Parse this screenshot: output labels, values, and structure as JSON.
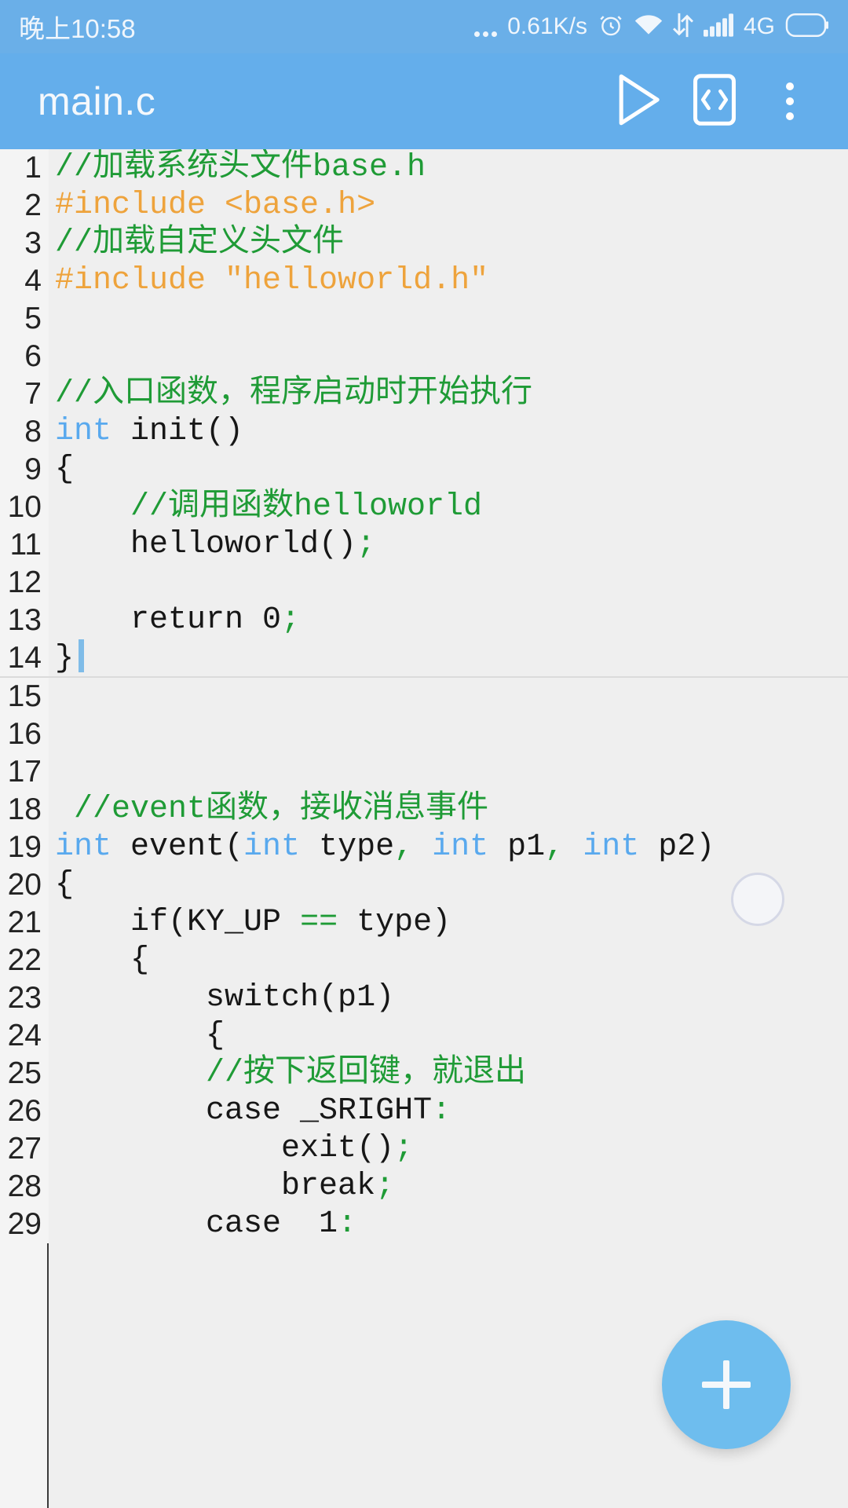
{
  "status_bar": {
    "clock": "晚上10:58",
    "network_speed": "0.61K/s",
    "network_type": "4G",
    "icons": [
      "more-dots-icon",
      "alarm-clock-icon",
      "wifi-icon",
      "data-transfer-icon",
      "signal-bars-icon",
      "battery-icon"
    ]
  },
  "app_bar": {
    "title": "main.c",
    "run_label": "run-icon",
    "code_label": "code-brackets-icon",
    "menu_label": "overflow-menu-icon"
  },
  "fab": {
    "label": "+",
    "color": "#6EBDEE"
  },
  "colors": {
    "accent": "#64AEEB",
    "status_bar": "#6AAFE8",
    "editor_bg": "#EFEFEF",
    "gutter_bg": "#F4F4F4",
    "comment": "#1F9B36",
    "preprocessor": "#EEA33C",
    "keyword": "#59A9EE",
    "punctuation": "#1F9B36",
    "text": "#171717",
    "caret": "#7FBCE8"
  },
  "editor": {
    "file_name": "main.c",
    "caret_line": 14,
    "lines": [
      {
        "n": "1",
        "tokens": [
          {
            "t": "//加载系统头文件base.h",
            "c": "comment"
          }
        ]
      },
      {
        "n": "2",
        "tokens": [
          {
            "t": "#include <base.h>",
            "c": "pre"
          }
        ]
      },
      {
        "n": "3",
        "tokens": [
          {
            "t": "//加载自定义头文件",
            "c": "comment"
          }
        ]
      },
      {
        "n": "4",
        "tokens": [
          {
            "t": "#include \"helloworld.h\"",
            "c": "pre"
          }
        ]
      },
      {
        "n": "5",
        "tokens": []
      },
      {
        "n": "6",
        "tokens": []
      },
      {
        "n": "7",
        "tokens": [
          {
            "t": "//入口函数，程序启动时开始执行",
            "c": "comment"
          }
        ]
      },
      {
        "n": "8",
        "tokens": [
          {
            "t": "int",
            "c": "kw"
          },
          {
            "t": " init()",
            "c": "plain"
          }
        ]
      },
      {
        "n": "9",
        "tokens": [
          {
            "t": "{",
            "c": "plain"
          }
        ]
      },
      {
        "n": "10",
        "tokens": [
          {
            "t": "    //调用函数helloworld",
            "c": "comment"
          }
        ]
      },
      {
        "n": "11",
        "tokens": [
          {
            "t": "    helloworld()",
            "c": "plain"
          },
          {
            "t": ";",
            "c": "punc"
          }
        ]
      },
      {
        "n": "12",
        "tokens": []
      },
      {
        "n": "13",
        "tokens": [
          {
            "t": "    return 0",
            "c": "plain"
          },
          {
            "t": ";",
            "c": "punc"
          }
        ]
      },
      {
        "n": "14",
        "tokens": [
          {
            "t": "}",
            "c": "plain"
          }
        ],
        "caret": true,
        "divider_below": true
      },
      {
        "n": "15",
        "tokens": []
      },
      {
        "n": "16",
        "tokens": []
      },
      {
        "n": "17",
        "tokens": []
      },
      {
        "n": "18",
        "tokens": [
          {
            "t": " //event函数，接收消息事件",
            "c": "comment"
          }
        ]
      },
      {
        "n": "19",
        "tokens": [
          {
            "t": "int",
            "c": "kw"
          },
          {
            "t": " event(",
            "c": "plain"
          },
          {
            "t": "int",
            "c": "kw"
          },
          {
            "t": " type",
            "c": "plain"
          },
          {
            "t": ",",
            "c": "punc"
          },
          {
            "t": " ",
            "c": "plain"
          },
          {
            "t": "int",
            "c": "kw"
          },
          {
            "t": " p1",
            "c": "plain"
          },
          {
            "t": ",",
            "c": "punc"
          },
          {
            "t": " ",
            "c": "plain"
          },
          {
            "t": "int",
            "c": "kw"
          },
          {
            "t": " p2)",
            "c": "plain"
          }
        ]
      },
      {
        "n": "20",
        "tokens": [
          {
            "t": "{",
            "c": "plain"
          }
        ]
      },
      {
        "n": "21",
        "tokens": [
          {
            "t": "    if(KY_UP ",
            "c": "plain"
          },
          {
            "t": "==",
            "c": "punc"
          },
          {
            "t": " type)",
            "c": "plain"
          }
        ]
      },
      {
        "n": "22",
        "tokens": [
          {
            "t": "    {",
            "c": "plain"
          }
        ]
      },
      {
        "n": "23",
        "tokens": [
          {
            "t": "        switch(p1)",
            "c": "plain"
          }
        ]
      },
      {
        "n": "24",
        "tokens": [
          {
            "t": "        {",
            "c": "plain"
          }
        ]
      },
      {
        "n": "25",
        "tokens": [
          {
            "t": "        //按下返回键，就退出",
            "c": "comment"
          }
        ]
      },
      {
        "n": "26",
        "tokens": [
          {
            "t": "        case _SRIGHT",
            "c": "plain"
          },
          {
            "t": ":",
            "c": "punc"
          }
        ]
      },
      {
        "n": "27",
        "tokens": [
          {
            "t": "            exit()",
            "c": "plain"
          },
          {
            "t": ";",
            "c": "punc"
          }
        ]
      },
      {
        "n": "28",
        "tokens": [
          {
            "t": "            break",
            "c": "plain"
          },
          {
            "t": ";",
            "c": "punc"
          }
        ]
      },
      {
        "n": "29",
        "tokens": [
          {
            "t": "        case  1",
            "c": "plain"
          },
          {
            "t": ":",
            "c": "punc"
          }
        ]
      }
    ]
  }
}
